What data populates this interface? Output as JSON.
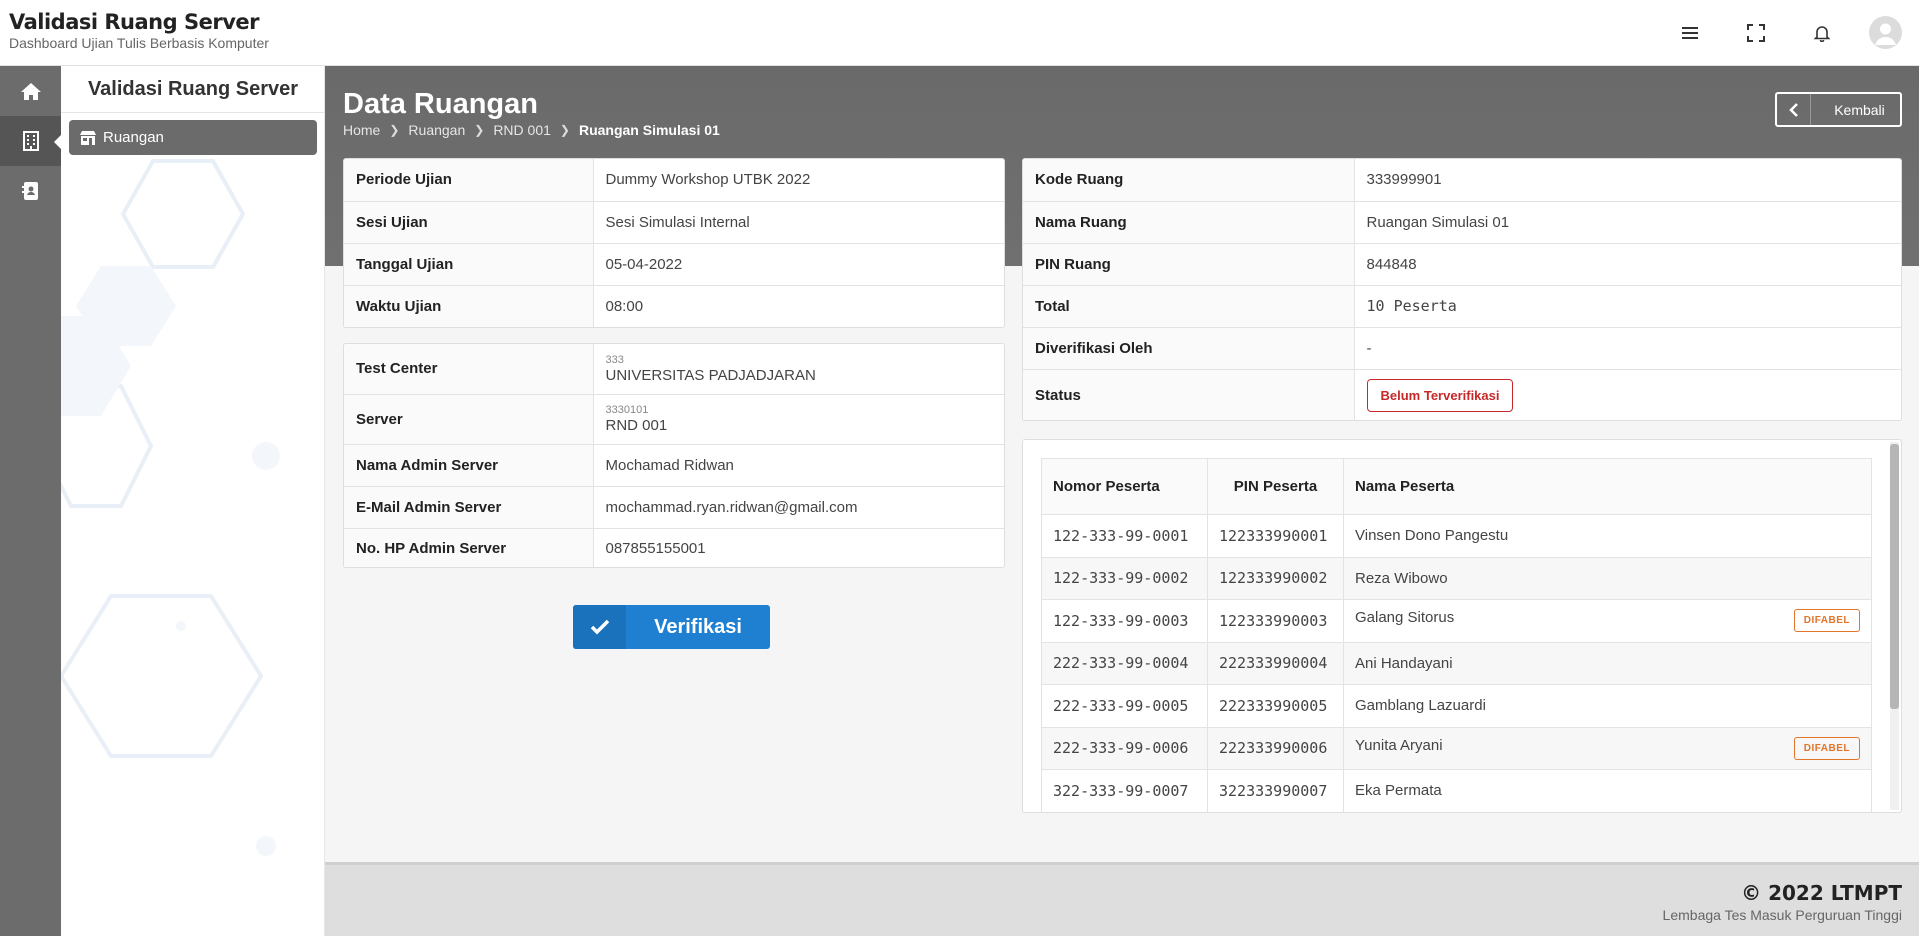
{
  "header": {
    "app_title": "Validasi Ruang Server",
    "app_subtitle": "Dashboard Ujian Tulis Berbasis Komputer",
    "icons": [
      "menu-icon",
      "fullscreen-icon",
      "bell-icon",
      "user-avatar"
    ]
  },
  "rail": {
    "items": [
      "home-icon",
      "building-icon",
      "contact-card-icon"
    ],
    "active_index": 1
  },
  "sidebar": {
    "title": "Validasi Ruang Server",
    "items": [
      {
        "label": "Ruangan",
        "icon": "store-icon"
      }
    ]
  },
  "page": {
    "title": "Data Ruangan",
    "breadcrumb": [
      "Home",
      "Ruangan",
      "RND 001",
      "Ruangan Simulasi 01"
    ],
    "back_label": "Kembali"
  },
  "exam_info": [
    {
      "key": "Periode Ujian",
      "value": "Dummy Workshop UTBK 2022"
    },
    {
      "key": "Sesi Ujian",
      "value": "Sesi Simulasi Internal"
    },
    {
      "key": "Tanggal Ujian",
      "value": "05-04-2022"
    },
    {
      "key": "Waktu Ujian",
      "value": "08:00"
    }
  ],
  "server_info": {
    "test_center_label": "Test Center",
    "test_center_code": "333",
    "test_center_name": "UNIVERSITAS PADJADJARAN",
    "server_label": "Server",
    "server_code": "3330101",
    "server_name": "RND 001",
    "admin_name_label": "Nama Admin Server",
    "admin_name": "Mochamad Ridwan",
    "admin_email_label": "E-Mail Admin Server",
    "admin_email": "mochammad.ryan.ridwan@gmail.com",
    "admin_phone_label": "No. HP Admin Server",
    "admin_phone": "087855155001"
  },
  "room_info": {
    "kode_label": "Kode Ruang",
    "kode": "333999901",
    "nama_label": "Nama Ruang",
    "nama": "Ruangan Simulasi 01",
    "pin_label": "PIN Ruang",
    "pin": "844848",
    "total_label": "Total",
    "total": "10 Peserta",
    "verifier_label": "Diverifikasi Oleh",
    "verifier": "-",
    "status_label": "Status",
    "status": "Belum Terverifikasi",
    "status_color": "#c62828"
  },
  "verify_button": {
    "label": "Verifikasi",
    "color": "#1f7fd0"
  },
  "participants": {
    "headers": [
      "Nomor Peserta",
      "PIN Peserta",
      "Nama Peserta"
    ],
    "rows": [
      {
        "nomor": "122-333-99-0001",
        "pin": "122333990001",
        "nama": "Vinsen Dono Pangestu",
        "badge": ""
      },
      {
        "nomor": "122-333-99-0002",
        "pin": "122333990002",
        "nama": "Reza Wibowo",
        "badge": ""
      },
      {
        "nomor": "122-333-99-0003",
        "pin": "122333990003",
        "nama": "Galang Sitorus",
        "badge": "DIFABEL"
      },
      {
        "nomor": "222-333-99-0004",
        "pin": "222333990004",
        "nama": "Ani Handayani",
        "badge": ""
      },
      {
        "nomor": "222-333-99-0005",
        "pin": "222333990005",
        "nama": "Gamblang Lazuardi",
        "badge": ""
      },
      {
        "nomor": "222-333-99-0006",
        "pin": "222333990006",
        "nama": "Yunita Aryani",
        "badge": "DIFABEL"
      },
      {
        "nomor": "322-333-99-0007",
        "pin": "322333990007",
        "nama": "Eka Permata",
        "badge": ""
      }
    ],
    "badge_color": "#e0752b"
  },
  "footer": {
    "copyright": "© 2022 LTMPT",
    "org": "Lembaga Tes Masuk Perguruan Tinggi"
  }
}
